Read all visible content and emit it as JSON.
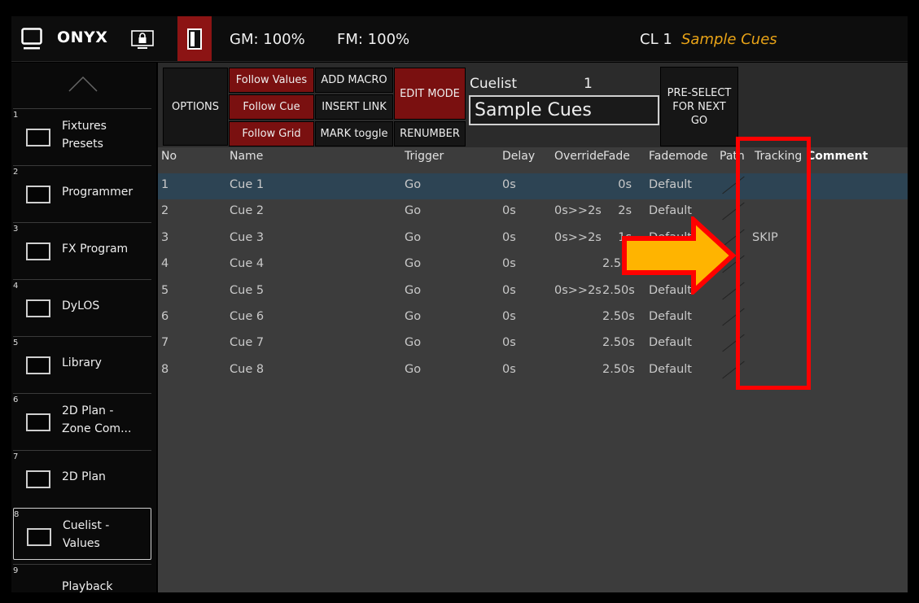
{
  "topbar": {
    "app_name": "ONYX",
    "gm": "GM: 100%",
    "fm": "FM: 100%",
    "cuelist_label": "CL 1",
    "cuelist_name": "Sample Cues"
  },
  "sidebar": {
    "items": [
      {
        "num": "1",
        "label": "Fixtures\nPresets"
      },
      {
        "num": "2",
        "label": "Programmer"
      },
      {
        "num": "3",
        "label": "FX Program"
      },
      {
        "num": "4",
        "label": "DyLOS"
      },
      {
        "num": "5",
        "label": "Library"
      },
      {
        "num": "6",
        "label": "2D Plan -\nZone Com..."
      },
      {
        "num": "7",
        "label": "2D Plan"
      },
      {
        "num": "8",
        "label": "Cuelist -\nValues"
      },
      {
        "num": "9",
        "label": "Playback"
      }
    ]
  },
  "toolbar": {
    "options": "OPTIONS",
    "follow_values": "Follow Values",
    "follow_cue": "Follow  Cue",
    "follow_grid": "Follow Grid",
    "add_macro": "ADD MACRO",
    "insert_link": "INSERT LINK",
    "mark_toggle": "MARK toggle",
    "edit_mode": "EDIT MODE",
    "renumber": "RENUMBER",
    "cuelist_label": "Cuelist",
    "cuelist_number": "1",
    "cuelist_name": "Sample Cues",
    "preselect": "PRE-SELECT\nFOR NEXT\nGO"
  },
  "table": {
    "headers": {
      "no": "No",
      "name": "Name",
      "trigger": "Trigger",
      "delay": "Delay",
      "override": "Override",
      "fade": "Fade",
      "fademode": "Fademode",
      "path": "Path",
      "tracking": "Tracking",
      "comment": "Comment"
    },
    "rows": [
      {
        "no": "1",
        "name": "Cue 1",
        "trigger": "Go",
        "delay": "0s",
        "override": "",
        "fade": "0s",
        "fademode": "Default",
        "tracking": ""
      },
      {
        "no": "2",
        "name": "Cue 2",
        "trigger": "Go",
        "delay": "0s",
        "override": "0s>>2s",
        "fade": "2s",
        "fademode": "Default",
        "tracking": ""
      },
      {
        "no": "3",
        "name": "Cue 3",
        "trigger": "Go",
        "delay": "0s",
        "override": "0s>>2s",
        "fade": "1s",
        "fademode": "Default",
        "tracking": "SKIP"
      },
      {
        "no": "4",
        "name": "Cue 4",
        "trigger": "Go",
        "delay": "0s",
        "override": "",
        "fade": "2.50s",
        "fademode": "Default",
        "tracking": ""
      },
      {
        "no": "5",
        "name": "Cue 5",
        "trigger": "Go",
        "delay": "0s",
        "override": "0s>>2s",
        "fade": "2.50s",
        "fademode": "Default",
        "tracking": ""
      },
      {
        "no": "6",
        "name": "Cue 6",
        "trigger": "Go",
        "delay": "0s",
        "override": "",
        "fade": "2.50s",
        "fademode": "Default",
        "tracking": ""
      },
      {
        "no": "7",
        "name": "Cue 7",
        "trigger": "Go",
        "delay": "0s",
        "override": "",
        "fade": "2.50s",
        "fademode": "Default",
        "tracking": ""
      },
      {
        "no": "8",
        "name": "Cue 8",
        "trigger": "Go",
        "delay": "0s",
        "override": "",
        "fade": "2.50s",
        "fademode": "Default",
        "tracking": ""
      }
    ]
  },
  "colors": {
    "accent_red": "#7a1010",
    "cuelist_name_orange": "#e8a317",
    "selected_row": "#2d4454",
    "annotation_red": "#ff0000",
    "annotation_arrow": "#ffb400"
  }
}
